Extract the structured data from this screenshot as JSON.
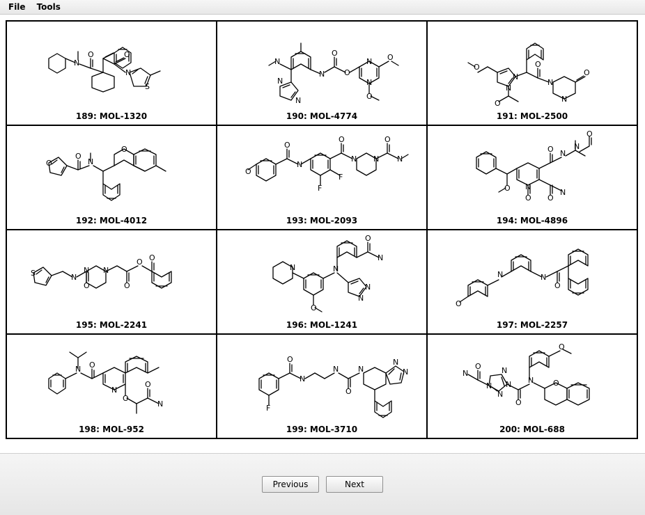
{
  "menubar": {
    "file": "File",
    "tools": "Tools"
  },
  "footer": {
    "previous": "Previous",
    "next": "Next"
  },
  "molecules": [
    {
      "index": 189,
      "id": "MOL-1320",
      "label": "189: MOL-1320"
    },
    {
      "index": 190,
      "id": "MOL-4774",
      "label": "190: MOL-4774"
    },
    {
      "index": 191,
      "id": "MOL-2500",
      "label": "191: MOL-2500"
    },
    {
      "index": 192,
      "id": "MOL-4012",
      "label": "192: MOL-4012"
    },
    {
      "index": 193,
      "id": "MOL-2093",
      "label": "193: MOL-2093"
    },
    {
      "index": 194,
      "id": "MOL-4896",
      "label": "194: MOL-4896"
    },
    {
      "index": 195,
      "id": "MOL-2241",
      "label": "195: MOL-2241"
    },
    {
      "index": 196,
      "id": "MOL-1241",
      "label": "196: MOL-1241"
    },
    {
      "index": 197,
      "id": "MOL-2257",
      "label": "197: MOL-2257"
    },
    {
      "index": 198,
      "id": "MOL-952",
      "label": "198: MOL-952"
    },
    {
      "index": 199,
      "id": "MOL-3710",
      "label": "199: MOL-3710"
    },
    {
      "index": 200,
      "id": "MOL-688",
      "label": "200: MOL-688"
    }
  ]
}
